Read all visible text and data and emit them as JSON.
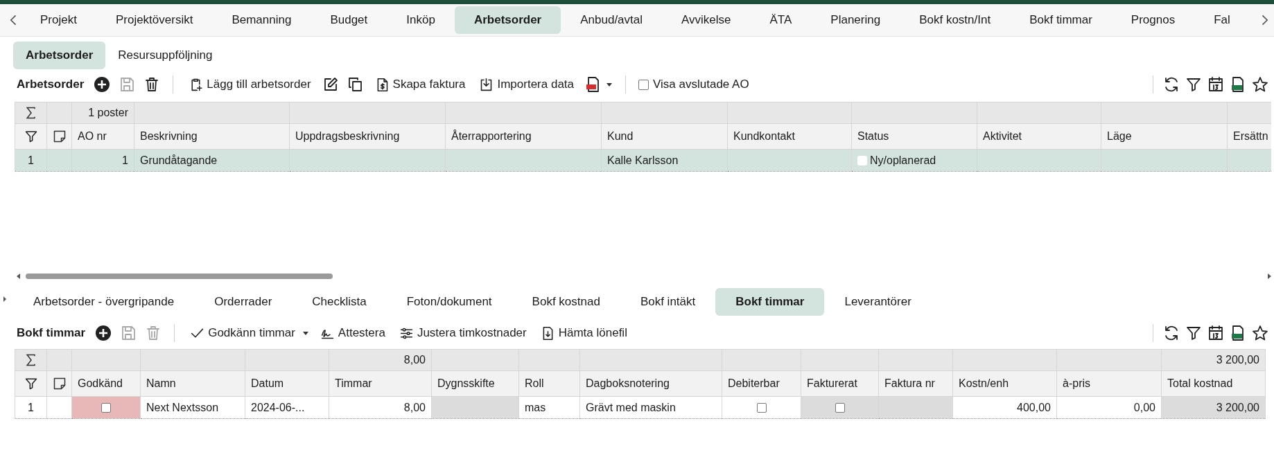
{
  "project_tabs": [
    {
      "label": "Projekt",
      "selected": false
    },
    {
      "label": "Projektöversikt",
      "selected": false
    },
    {
      "label": "Bemanning",
      "selected": false
    },
    {
      "label": "Budget",
      "selected": false
    },
    {
      "label": "Inköp",
      "selected": false
    },
    {
      "label": "Arbetsorder",
      "selected": true
    },
    {
      "label": "Anbud/avtal",
      "selected": false
    },
    {
      "label": "Avvikelse",
      "selected": false
    },
    {
      "label": "ÄTA",
      "selected": false
    },
    {
      "label": "Planering",
      "selected": false
    },
    {
      "label": "Bokf kostn/Int",
      "selected": false
    },
    {
      "label": "Bokf timmar",
      "selected": false
    },
    {
      "label": "Prognos",
      "selected": false
    },
    {
      "label": "Fal",
      "selected": false
    }
  ],
  "sub_tabs": [
    {
      "label": "Arbetsorder",
      "selected": true
    },
    {
      "label": "Resursuppföljning",
      "selected": false
    }
  ],
  "work_orders": {
    "title": "Arbetsorder",
    "toolbar": [
      {
        "kind": "add",
        "disabled": false
      },
      {
        "kind": "save",
        "disabled": true
      },
      {
        "kind": "delete",
        "disabled": false
      },
      {
        "kind": "sep"
      },
      {
        "kind": "add-order",
        "label": "Lägg till arbetsorder",
        "disabled": false
      },
      {
        "kind": "edit",
        "disabled": false
      },
      {
        "kind": "copy",
        "disabled": false
      },
      {
        "kind": "invoice",
        "label": "Skapa faktura",
        "disabled": false
      },
      {
        "kind": "import",
        "label": "Importera data",
        "disabled": false
      },
      {
        "kind": "pdf",
        "disabled": false
      },
      {
        "kind": "sep"
      },
      {
        "kind": "toggle",
        "label": "Visa avslutade AO",
        "checked": false
      }
    ],
    "toolbar_right": [
      {
        "kind": "refresh"
      },
      {
        "kind": "filter"
      },
      {
        "kind": "calendar"
      },
      {
        "kind": "excel"
      },
      {
        "kind": "star"
      }
    ],
    "grid": {
      "columns": [
        {
          "label": "AO nr",
          "kind": "number",
          "summary": "1 poster"
        },
        {
          "label": "Beskrivning",
          "kind": "text"
        },
        {
          "label": "Uppdragsbeskrivning",
          "kind": "text"
        },
        {
          "label": "Återrapportering",
          "kind": "text"
        },
        {
          "label": "Kund",
          "kind": "text"
        },
        {
          "label": "Kundkontakt",
          "kind": "text"
        },
        {
          "label": "Status",
          "kind": "text"
        },
        {
          "label": "Aktivitet",
          "kind": "text"
        },
        {
          "label": "Läge",
          "kind": "text"
        },
        {
          "label": "Ersättn",
          "kind": "text"
        }
      ],
      "rows": [
        {
          "number": "1",
          "selected": true,
          "cells": [
            "1",
            "Grundåtagande",
            null,
            null,
            "Kalle Karlsson",
            null,
            {
              "kind": "status",
              "text": "Ny/oplanerad",
              "color": "#ffffff"
            },
            null,
            null,
            null
          ]
        }
      ]
    }
  },
  "detail_tabs": [
    {
      "label": "Arbetsorder - övergripande",
      "selected": false
    },
    {
      "label": "Orderrader",
      "selected": false
    },
    {
      "label": "Checklista",
      "selected": false
    },
    {
      "label": "Foton/dokument",
      "selected": false
    },
    {
      "label": "Bokf kostnad",
      "selected": false
    },
    {
      "label": "Bokf intäkt",
      "selected": false
    },
    {
      "label": "Bokf timmar",
      "selected": true
    },
    {
      "label": "Leverantörer",
      "selected": false
    }
  ],
  "hours": {
    "title": "Bokf timmar",
    "toolbar": [
      {
        "kind": "add",
        "disabled": false
      },
      {
        "kind": "save",
        "disabled": true
      },
      {
        "kind": "delete",
        "disabled": true
      },
      {
        "kind": "sep"
      },
      {
        "kind": "approve",
        "label": "Godkänn timmar",
        "disabled": false
      },
      {
        "kind": "attest",
        "label": "Attestera",
        "disabled": false
      },
      {
        "kind": "adjust",
        "label": "Justera timkostnader",
        "disabled": false
      },
      {
        "kind": "download",
        "label": "Hämta lönefil",
        "disabled": false
      }
    ],
    "toolbar_right": [
      {
        "kind": "refresh"
      },
      {
        "kind": "filter"
      },
      {
        "kind": "calendar"
      },
      {
        "kind": "excel"
      },
      {
        "kind": "star"
      }
    ],
    "grid": {
      "columns": [
        {
          "label": "Godkänd",
          "kind": "check",
          "readonly": false
        },
        {
          "label": "Namn",
          "kind": "text",
          "readonly": false
        },
        {
          "label": "Datum",
          "kind": "text",
          "readonly": false
        },
        {
          "label": "Timmar",
          "kind": "number",
          "readonly": false,
          "summary": "8,00"
        },
        {
          "label": "Dygnsskifte",
          "kind": "text",
          "readonly": true
        },
        {
          "label": "Roll",
          "kind": "text",
          "readonly": false
        },
        {
          "label": "Dagboksnotering",
          "kind": "text",
          "readonly": false
        },
        {
          "label": "Debiterbar",
          "kind": "check",
          "readonly": false
        },
        {
          "label": "Fakturerat",
          "kind": "check",
          "readonly": true
        },
        {
          "label": "Faktura nr",
          "kind": "text",
          "readonly": true
        },
        {
          "label": "Kostn/enh",
          "kind": "number",
          "readonly": false
        },
        {
          "label": "à-pris",
          "kind": "number",
          "readonly": false
        },
        {
          "label": "Total kostnad",
          "kind": "number",
          "readonly": true,
          "summary": "3 200,00"
        }
      ],
      "rows": [
        {
          "number": "1",
          "selected": false,
          "cells": [
            {
              "kind": "check",
              "checked": false,
              "flagged": true
            },
            "Next Nextsson",
            "2024-06-...",
            "8,00",
            null,
            "mas",
            "Grävt med maskin",
            {
              "kind": "check",
              "checked": false,
              "flagged": false
            },
            {
              "kind": "check",
              "checked": false,
              "flagged": false
            },
            null,
            "400,00",
            "0,00",
            "3 200,00"
          ]
        }
      ]
    }
  }
}
